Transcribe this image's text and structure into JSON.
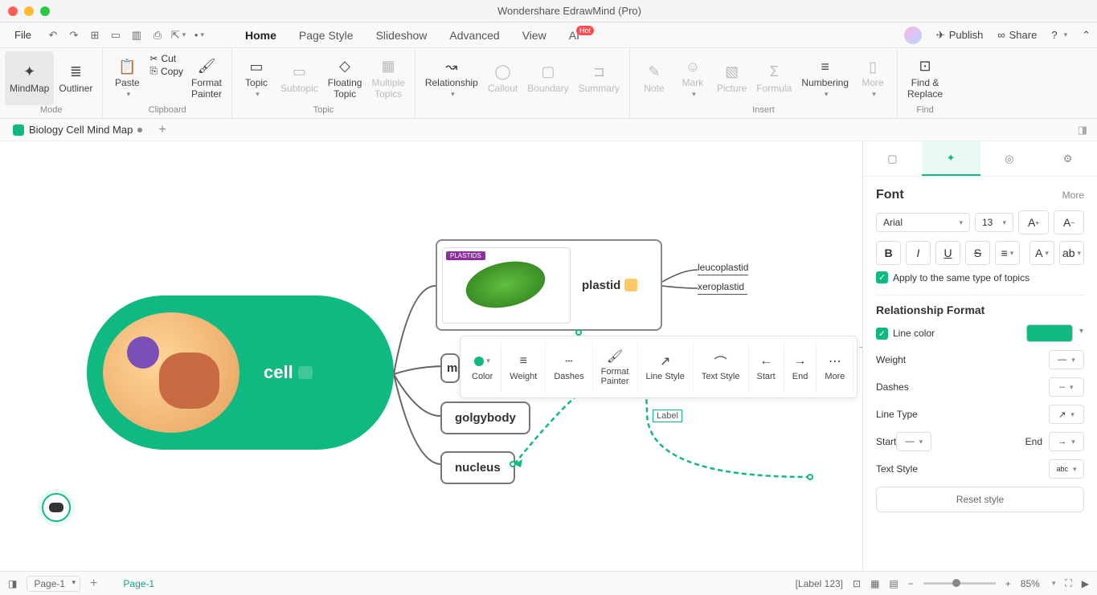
{
  "window": {
    "title": "Wondershare EdrawMind (Pro)"
  },
  "menubar": {
    "file": "File",
    "tabs": [
      "Home",
      "Page Style",
      "Slideshow",
      "Advanced",
      "View",
      "AI"
    ],
    "active_tab": 0,
    "hot": "Hot",
    "publish": "Publish",
    "share": "Share"
  },
  "ribbon": {
    "mode": {
      "label": "Mode",
      "mindmap": "MindMap",
      "outliner": "Outliner"
    },
    "clipboard": {
      "label": "Clipboard",
      "paste": "Paste",
      "cut": "Cut",
      "copy": "Copy",
      "format_painter": "Format\nPainter"
    },
    "topic": {
      "label": "Topic",
      "topic": "Topic",
      "subtopic": "Subtopic",
      "floating": "Floating\nTopic",
      "multiple": "Multiple\nTopics"
    },
    "rel": {
      "relationship": "Relationship",
      "callout": "Callout",
      "boundary": "Boundary",
      "summary": "Summary"
    },
    "insert": {
      "label": "Insert",
      "note": "Note",
      "mark": "Mark",
      "picture": "Picture",
      "formula": "Formula",
      "numbering": "Numbering",
      "more": "More"
    },
    "find": {
      "label": "Find",
      "findreplace": "Find &\nReplace"
    }
  },
  "doctab": {
    "name": "Biology Cell Mind Map"
  },
  "mindmap": {
    "center": "cell",
    "plastid": "plastid",
    "plastids_header": "PLASTIDS",
    "m_node": "m",
    "golgy": "golgybody",
    "nucleus": "nucleus",
    "leaves": [
      "leucoplastid",
      "xeroplastid"
    ],
    "rel_label": "Label"
  },
  "float_toolbar": {
    "color": "Color",
    "weight": "Weight",
    "dashes": "Dashes",
    "format_painter": "Format\nPainter",
    "line_style": "Line Style",
    "text_style": "Text Style",
    "start": "Start",
    "end": "End",
    "more": "More"
  },
  "panel": {
    "font": "Font",
    "more": "More",
    "font_name": "Arial",
    "font_size": "13",
    "apply_same": "Apply to the same type of topics",
    "rel_format": "Relationship Format",
    "line_color": "Line color",
    "weight": "Weight",
    "dashes": "Dashes",
    "line_type": "Line Type",
    "start": "Start",
    "end": "End",
    "text_style": "Text Style",
    "reset": "Reset style",
    "color_hex": "#10b981"
  },
  "status": {
    "page_sel": "Page-1",
    "page_label": "Page-1",
    "label_indicator": "[Label 123]",
    "zoom": "85%"
  }
}
